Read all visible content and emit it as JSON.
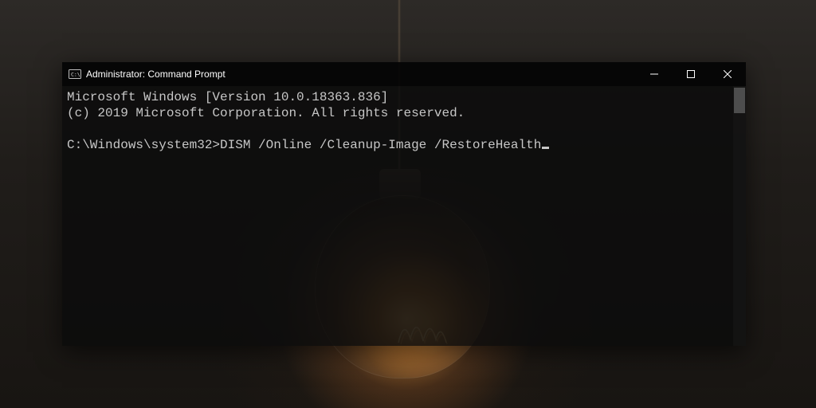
{
  "window": {
    "title": "Administrator: Command Prompt",
    "icon_name": "cmd-icon"
  },
  "terminal": {
    "line1": "Microsoft Windows [Version 10.0.18363.836]",
    "line2": "(c) 2019 Microsoft Corporation. All rights reserved.",
    "blank": "",
    "prompt": "C:\\Windows\\system32>",
    "command": "DISM /Online /Cleanup-Image /RestoreHealth"
  },
  "colors": {
    "terminal_bg": "rgba(12,12,12,0.86)",
    "terminal_fg": "#c7c7c7",
    "titlebar_fg": "#ffffff"
  }
}
